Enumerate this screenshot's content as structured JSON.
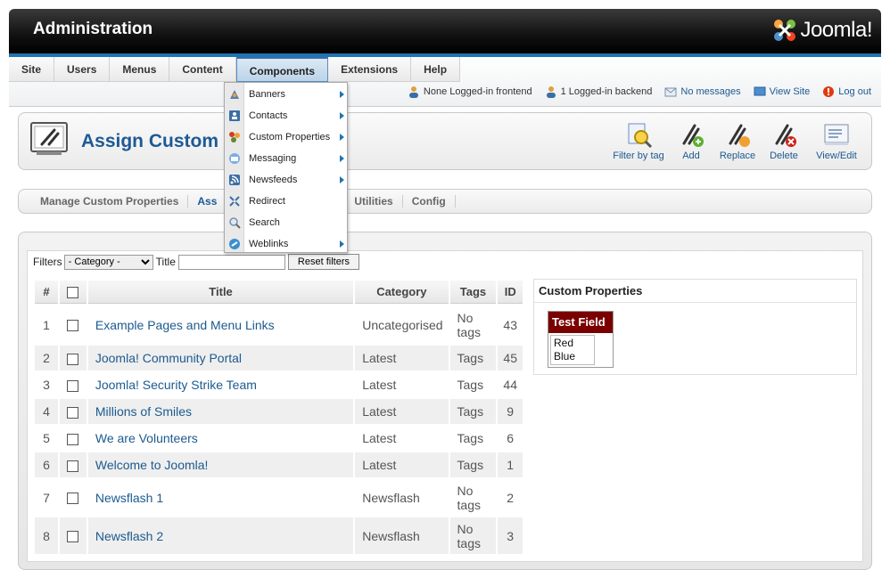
{
  "header": {
    "title": "Administration",
    "logo_text": "Joomla!"
  },
  "menu": [
    "Site",
    "Users",
    "Menus",
    "Content",
    "Components",
    "Extensions",
    "Help"
  ],
  "status": {
    "frontend": "None Logged-in frontend",
    "backend": "1 Logged-in backend",
    "messages": "No messages",
    "view_site": "View Site",
    "logout": "Log out"
  },
  "page": {
    "title": "Assign Custom"
  },
  "toolbar": [
    {
      "label": "Filter by tag",
      "icon": "filter-tag-icon"
    },
    {
      "label": "Add",
      "icon": "add-tag-icon"
    },
    {
      "label": "Replace",
      "icon": "replace-tag-icon"
    },
    {
      "label": "Delete",
      "icon": "delete-tag-icon"
    },
    {
      "label": "View/Edit",
      "icon": "view-edit-icon"
    }
  ],
  "subnav": [
    "Manage Custom Properties",
    "Ass",
    "Utilities",
    "Config"
  ],
  "components_menu": [
    {
      "label": "Banners",
      "icon": "banners-icon",
      "submenu": true
    },
    {
      "label": "Contacts",
      "icon": "contacts-icon",
      "submenu": true
    },
    {
      "label": "Custom Properties",
      "icon": "custom-properties-icon",
      "submenu": true
    },
    {
      "label": "Messaging",
      "icon": "messaging-icon",
      "submenu": true
    },
    {
      "label": "Newsfeeds",
      "icon": "newsfeeds-icon",
      "submenu": true
    },
    {
      "label": "Redirect",
      "icon": "redirect-icon",
      "submenu": false
    },
    {
      "label": "Search",
      "icon": "search-icon",
      "submenu": false
    },
    {
      "label": "Weblinks",
      "icon": "weblinks-icon",
      "submenu": true
    }
  ],
  "filters": {
    "label": "Filters",
    "category_value": "- Category -",
    "title_label": "Title",
    "title_value": "",
    "reset_label": "Reset filters"
  },
  "table": {
    "headers": {
      "num": "#",
      "title": "Title",
      "category": "Category",
      "tags": "Tags",
      "id": "ID"
    },
    "rows": [
      {
        "num": "1",
        "title": "Example Pages and Menu Links",
        "category": "Uncategorised",
        "tags": "No tags",
        "id": "43"
      },
      {
        "num": "2",
        "title": "Joomla! Community Portal",
        "category": "Latest",
        "tags": "Tags",
        "id": "45"
      },
      {
        "num": "3",
        "title": "Joomla! Security Strike Team",
        "category": "Latest",
        "tags": "Tags",
        "id": "44"
      },
      {
        "num": "4",
        "title": "Millions of Smiles",
        "category": "Latest",
        "tags": "Tags",
        "id": "9"
      },
      {
        "num": "5",
        "title": "We are Volunteers",
        "category": "Latest",
        "tags": "Tags",
        "id": "6"
      },
      {
        "num": "6",
        "title": "Welcome to Joomla!",
        "category": "Latest",
        "tags": "Tags",
        "id": "1"
      },
      {
        "num": "7",
        "title": "Newsflash 1",
        "category": "Newsflash",
        "tags": "No tags",
        "id": "2"
      },
      {
        "num": "8",
        "title": "Newsflash 2",
        "category": "Newsflash",
        "tags": "No tags",
        "id": "3"
      }
    ]
  },
  "custom_properties": {
    "heading": "Custom Properties",
    "field_name": "Test Field",
    "options": [
      "Red",
      "Blue"
    ]
  },
  "colors": {
    "accent": "#1d5a94",
    "header_bg": "#111111",
    "field_header": "#7a0000",
    "strip": "#1e74b3"
  }
}
